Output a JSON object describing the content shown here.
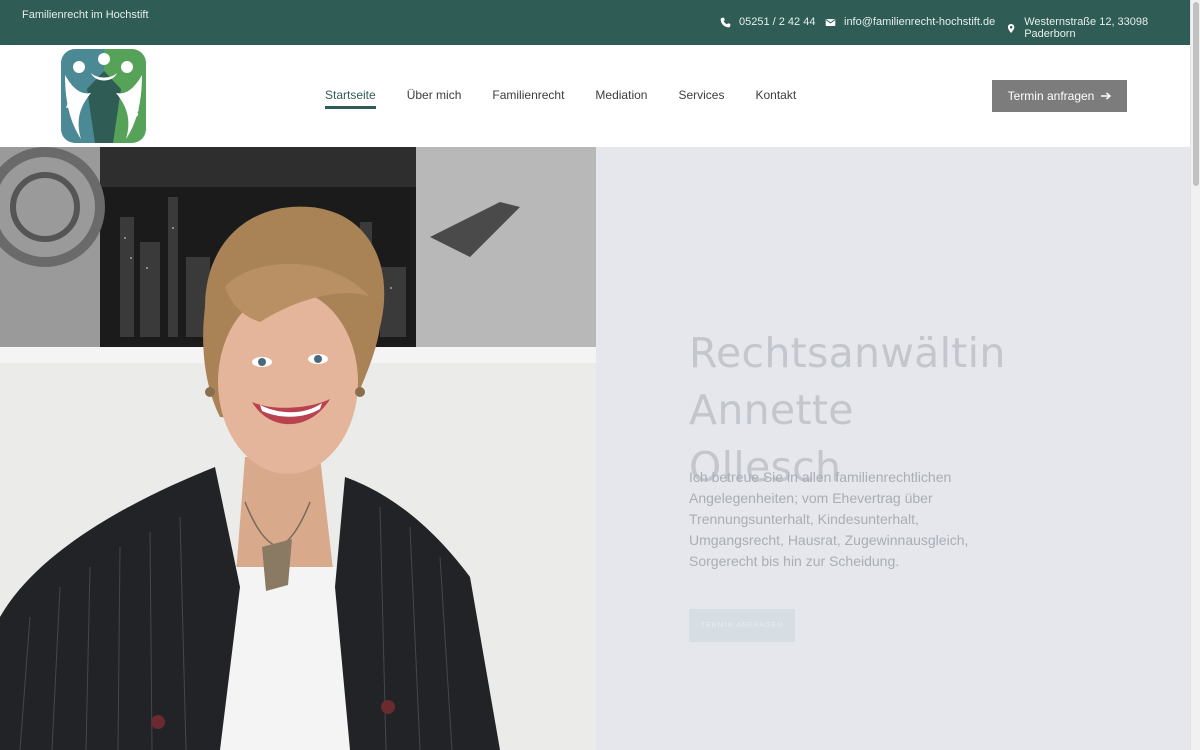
{
  "topbar": {
    "tagline": "Familienrecht im Hochstift",
    "phone": "05251 / 2 42 44",
    "email": "info@familienrecht-hochstift.de",
    "address": "Westernstraße 12, 33098 Paderborn"
  },
  "nav": {
    "items": [
      {
        "label": "Startseite",
        "active": true
      },
      {
        "label": "Über mich"
      },
      {
        "label": "Familienrecht"
      },
      {
        "label": "Mediation"
      },
      {
        "label": "Services"
      },
      {
        "label": "Kontakt"
      }
    ],
    "cta_label": "Termin anfragen"
  },
  "hero": {
    "title_line1": "Rechtsanwältin Annette",
    "title_line2": "Ollesch",
    "text": "Ich betreue Sie in allen familienrechtlichen Angelegenheiten; vom Ehevertrag über Trennungsunterhalt, Kindesunterhalt, Umgangsrecht, Hausrat, Zugewinnausgleich, Sorgerecht bis hin zur Scheidung.",
    "button_label": "TERMIN ANFRAGEN"
  },
  "colors": {
    "brand_green": "#2f5c54",
    "logo_teal": "#4b8a95",
    "logo_green": "#57a259",
    "cta_gray": "#7c7c7c",
    "hero_bg": "#e5e7ec"
  },
  "icons": [
    "phone-icon",
    "envelope-icon",
    "map-pin-icon",
    "arrow-right-icon",
    "logo-people-icon"
  ]
}
